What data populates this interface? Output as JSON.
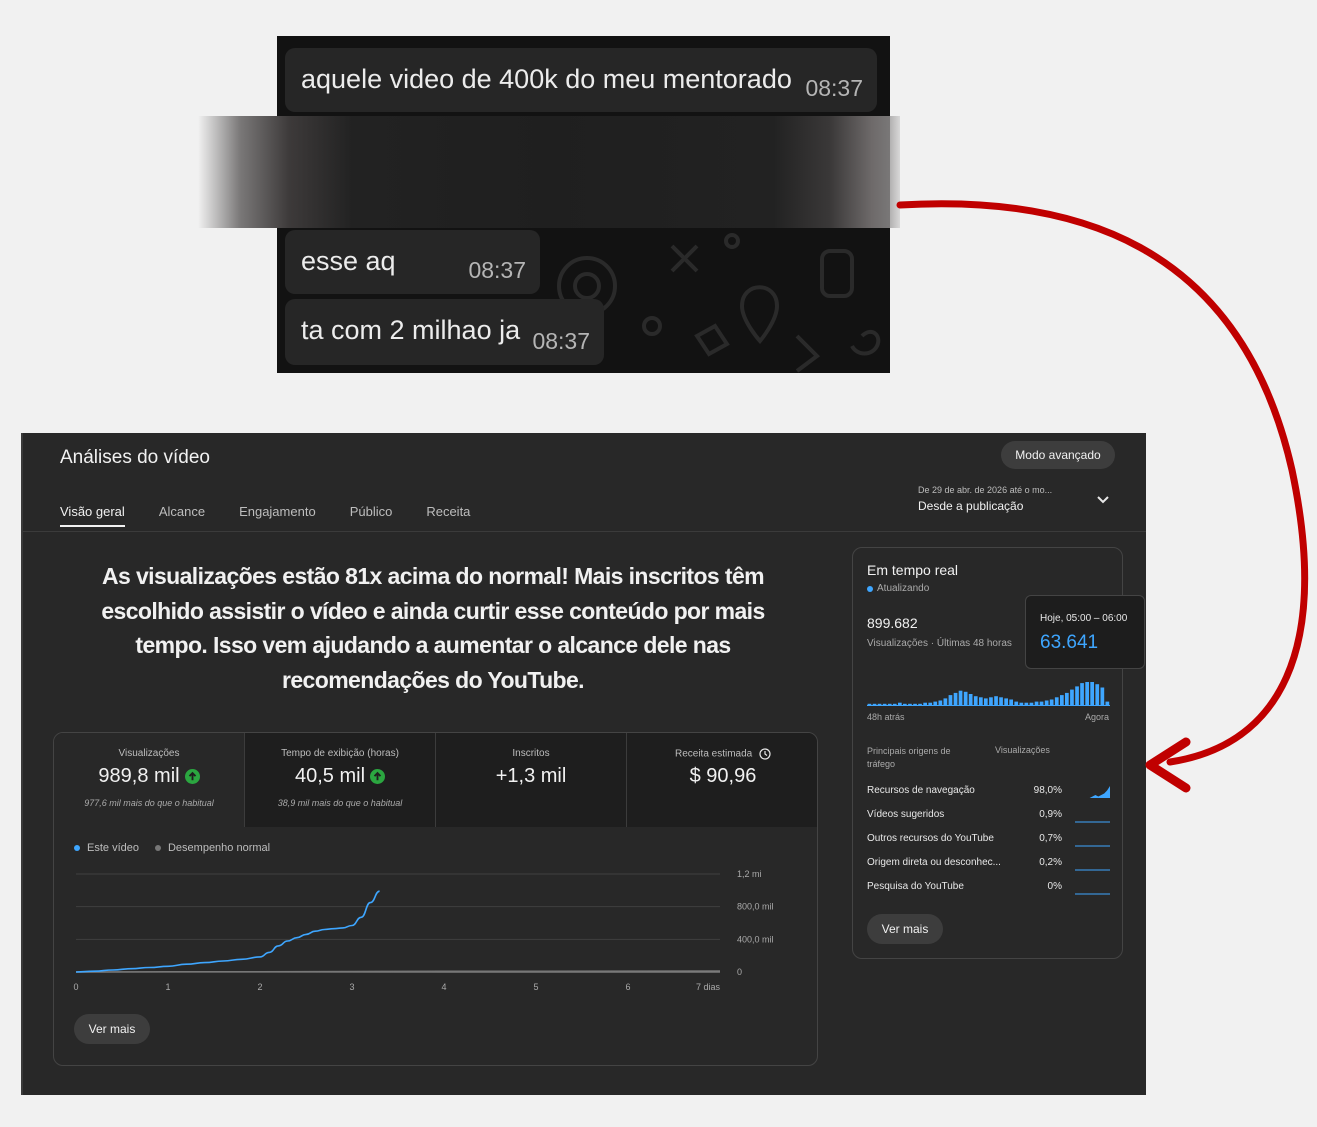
{
  "chat": {
    "messages": [
      {
        "text": "aquele video de 400k  do meu mentorado",
        "time": "08:37"
      },
      {
        "text": "esse aq",
        "time": "08:37"
      },
      {
        "text": "ta com 2 milhao ja",
        "time": "08:37"
      }
    ]
  },
  "colors": {
    "accent": "#3ea6ff",
    "arrow": "#c00000",
    "up": "#2ba640",
    "panel_bg": "#282828"
  },
  "analytics": {
    "title": "Análises do vídeo",
    "advanced_button": "Modo avançado",
    "tabs": [
      "Visão geral",
      "Alcance",
      "Engajamento",
      "Público",
      "Receita"
    ],
    "active_tab": 0,
    "date_range": {
      "sub": "De 29 de abr. de 2026 até o mo...",
      "main": "Desde a publicação"
    },
    "headline": "As visualizações estão 81x acima do normal! Mais inscritos têm escolhido assistir o vídeo e ainda curtir esse conteúdo por mais tempo. Isso vem ajudando a aumentar o alcance dele nas recomendações do YouTube.",
    "metrics": [
      {
        "label": "Visualizações",
        "value": "989,8 mil",
        "up": true,
        "sub": "977,6 mil mais do que o habitual"
      },
      {
        "label": "Tempo de exibição (horas)",
        "value": "40,5 mil",
        "up": true,
        "sub": "38,9 mil mais do que o habitual"
      },
      {
        "label": "Inscritos",
        "value": "+1,3 mil",
        "up": false,
        "sub": ""
      },
      {
        "label": "Receita estimada",
        "value": "$ 90,96",
        "up": false,
        "sub": "",
        "icon": "clock-icon"
      }
    ],
    "legend": {
      "this_video": "Este vídeo",
      "normal": "Desempenho normal"
    },
    "see_more": "Ver mais"
  },
  "chart_data": {
    "type": "line",
    "title": "",
    "xlabel": "",
    "ylabel": "",
    "x_ticks": [
      "0",
      "1",
      "2",
      "3",
      "4",
      "5",
      "6",
      "7 dias"
    ],
    "y_ticks": [
      "0",
      "400,0 mil",
      "800,0 mil",
      "1,2 mi"
    ],
    "ylim": [
      0,
      1200000
    ],
    "xlim": [
      0,
      7
    ],
    "grid": true,
    "series": [
      {
        "name": "Este vídeo",
        "x": [
          0,
          0.2,
          0.4,
          0.6,
          0.8,
          1.0,
          1.2,
          1.4,
          1.6,
          1.8,
          2.0,
          2.1,
          2.2,
          2.3,
          2.4,
          2.5,
          2.6,
          2.7,
          2.8,
          2.9,
          3.0,
          3.1,
          3.2,
          3.3
        ],
        "y": [
          0,
          10000,
          25000,
          40000,
          55000,
          70000,
          95000,
          115000,
          135000,
          155000,
          185000,
          240000,
          320000,
          380000,
          420000,
          460000,
          500000,
          520000,
          530000,
          540000,
          570000,
          670000,
          850000,
          990000
        ]
      },
      {
        "name": "Desempenho normal",
        "x": [
          0,
          1,
          2,
          3,
          4,
          5,
          6,
          7
        ],
        "y": [
          0,
          2000,
          4000,
          6000,
          8000,
          10000,
          11000,
          12000
        ]
      }
    ]
  },
  "realtime": {
    "title": "Em tempo real",
    "status": "Atualizando",
    "views": "899.682",
    "views_sub": "Visualizações · Últimas 48 horas",
    "tooltip": {
      "label": "Hoje, 05:00 – 06:00",
      "value": "63.641"
    },
    "axis_start": "48h atrás",
    "axis_end": "Agora",
    "hourly_bars": [
      2,
      2,
      2,
      2,
      2,
      2,
      3,
      2,
      2,
      2,
      2,
      3,
      3,
      4,
      5,
      7,
      10,
      12,
      14,
      13,
      11,
      9,
      8,
      7,
      8,
      9,
      8,
      7,
      6,
      4,
      3,
      3,
      3,
      4,
      4,
      5,
      6,
      8,
      10,
      12,
      15,
      18,
      21,
      22,
      22,
      20,
      17,
      4
    ],
    "col_sources": "Principais origens de tráfego",
    "col_views": "Visualizações",
    "sources": [
      {
        "name": "Recursos de navegação",
        "pct": "98,0%",
        "trend": [
          1,
          1,
          1,
          1,
          1,
          1,
          2,
          3,
          2,
          3,
          4,
          6,
          9
        ]
      },
      {
        "name": "Vídeos sugeridos",
        "pct": "0,9%",
        "trend": [
          1,
          1,
          1,
          1,
          1,
          1,
          1,
          1,
          1,
          1,
          1,
          1,
          1
        ]
      },
      {
        "name": "Outros recursos do YouTube",
        "pct": "0,7%",
        "trend": [
          1,
          1,
          1,
          1,
          1,
          1,
          1,
          1,
          1,
          1,
          1,
          1,
          1
        ]
      },
      {
        "name": "Origem direta ou desconhec...",
        "pct": "0,2%",
        "trend": [
          1,
          1,
          1,
          1,
          1,
          1,
          1,
          1,
          1,
          1,
          1,
          1,
          1
        ]
      },
      {
        "name": "Pesquisa do YouTube",
        "pct": "0%",
        "trend": [
          1,
          1,
          1,
          1,
          1,
          1,
          1,
          1,
          1,
          1,
          1,
          1,
          1
        ]
      }
    ],
    "see_more": "Ver mais"
  }
}
